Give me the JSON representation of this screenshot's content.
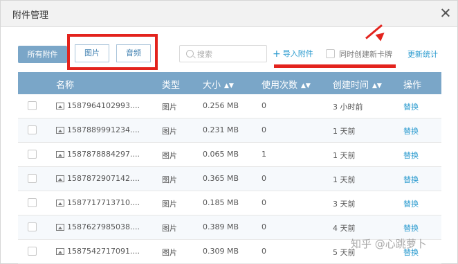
{
  "dialog": {
    "title": "附件管理"
  },
  "toolbar": {
    "tab_all": "所有附件",
    "tab_image": "图片",
    "tab_audio": "音频",
    "search_placeholder": "搜索",
    "import_label": "导入附件",
    "create_card_label": "同时创建新卡牌",
    "update_stats_label": "更新统计"
  },
  "table": {
    "headers": {
      "name": "名称",
      "type": "类型",
      "size": "大小",
      "count": "使用次数",
      "time": "创建时间",
      "action": "操作"
    },
    "rows": [
      {
        "name": "1587964102993....",
        "type": "图片",
        "size": "0.256 MB",
        "count": "0",
        "time": "3 小时前",
        "action": "替换"
      },
      {
        "name": "1587889991234....",
        "type": "图片",
        "size": "0.231 MB",
        "count": "0",
        "time": "1 天前",
        "action": "替换"
      },
      {
        "name": "1587878884297....",
        "type": "图片",
        "size": "0.065 MB",
        "count": "1",
        "time": "1 天前",
        "action": "替换"
      },
      {
        "name": "1587872907142....",
        "type": "图片",
        "size": "0.365 MB",
        "count": "0",
        "time": "1 天前",
        "action": "替换"
      },
      {
        "name": "1587717713710....",
        "type": "图片",
        "size": "0.185 MB",
        "count": "0",
        "time": "3 天前",
        "action": "替换"
      },
      {
        "name": "1587627985038....",
        "type": "图片",
        "size": "0.389 MB",
        "count": "0",
        "time": "4 天前",
        "action": "替换"
      },
      {
        "name": "1587542717091....",
        "type": "图片",
        "size": "0.309 MB",
        "count": "0",
        "time": "5 天前",
        "action": "替换"
      }
    ]
  },
  "watermark": "知乎 @心跳萝卜",
  "colors": {
    "header_bg": "#7aa6c8",
    "accent_link": "#2b9bcf",
    "annotation_red": "#e3231d"
  },
  "icons": [
    "close-icon",
    "search-icon",
    "plus-icon",
    "image-file-icon",
    "sort-icon"
  ]
}
